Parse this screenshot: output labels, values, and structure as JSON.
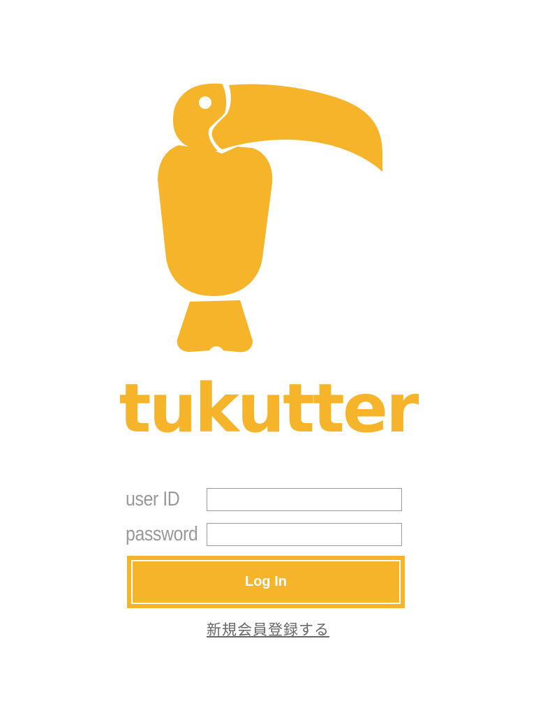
{
  "app": {
    "brand_name": "tukutter",
    "brand_color": "#f6b42b",
    "logo_icon": "toucan-icon"
  },
  "login_form": {
    "user_id_label": "user ID",
    "user_id_value": "",
    "password_label": "password",
    "password_value": "",
    "login_button_label": "Log In"
  },
  "register": {
    "link_label": "新規会員登録する"
  }
}
